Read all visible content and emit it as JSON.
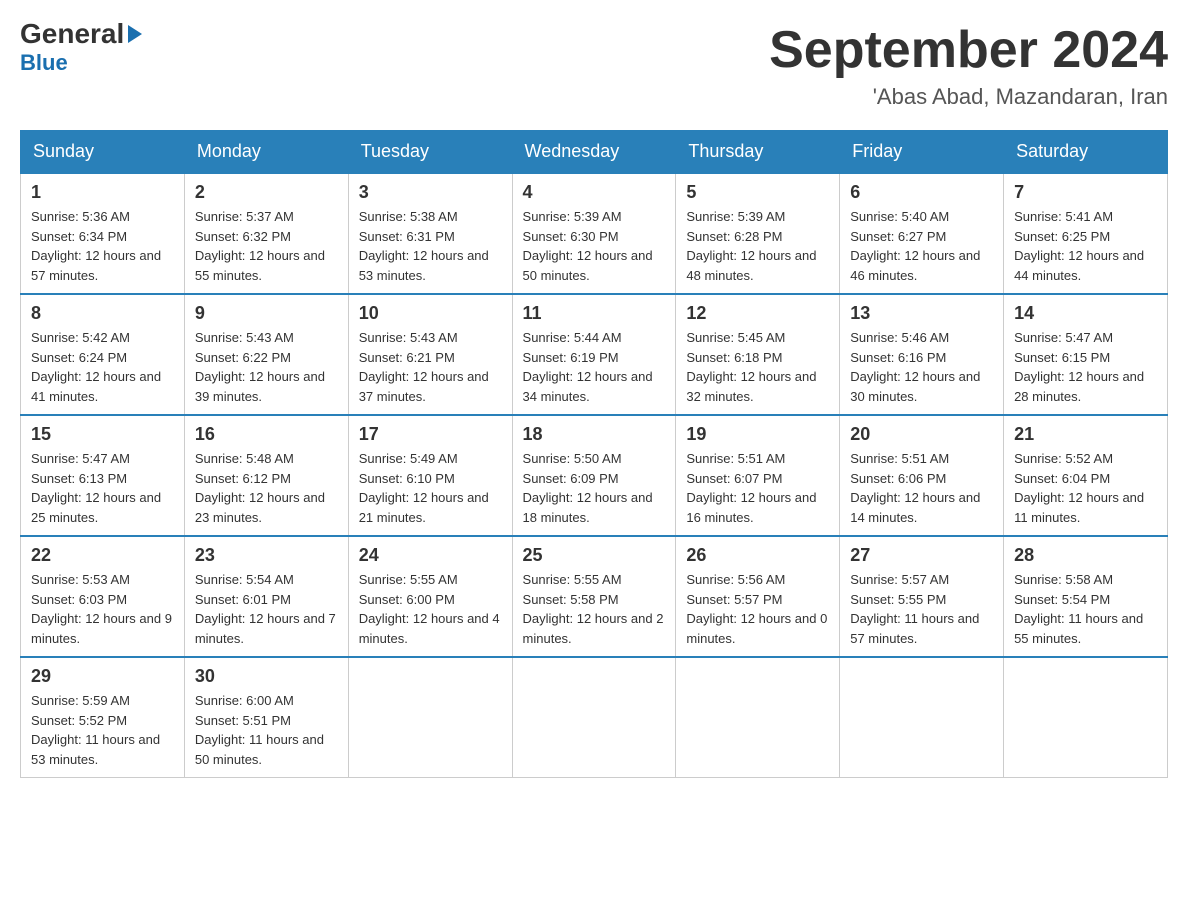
{
  "header": {
    "logo_general": "General",
    "logo_blue": "Blue",
    "logo_arrow": "▶",
    "title": "September 2024",
    "subtitle": "'Abas Abad, Mazandaran, Iran"
  },
  "days_of_week": [
    "Sunday",
    "Monday",
    "Tuesday",
    "Wednesday",
    "Thursday",
    "Friday",
    "Saturday"
  ],
  "weeks": [
    [
      {
        "date": "1",
        "sunrise": "5:36 AM",
        "sunset": "6:34 PM",
        "daylight": "12 hours and 57 minutes."
      },
      {
        "date": "2",
        "sunrise": "5:37 AM",
        "sunset": "6:32 PM",
        "daylight": "12 hours and 55 minutes."
      },
      {
        "date": "3",
        "sunrise": "5:38 AM",
        "sunset": "6:31 PM",
        "daylight": "12 hours and 53 minutes."
      },
      {
        "date": "4",
        "sunrise": "5:39 AM",
        "sunset": "6:30 PM",
        "daylight": "12 hours and 50 minutes."
      },
      {
        "date": "5",
        "sunrise": "5:39 AM",
        "sunset": "6:28 PM",
        "daylight": "12 hours and 48 minutes."
      },
      {
        "date": "6",
        "sunrise": "5:40 AM",
        "sunset": "6:27 PM",
        "daylight": "12 hours and 46 minutes."
      },
      {
        "date": "7",
        "sunrise": "5:41 AM",
        "sunset": "6:25 PM",
        "daylight": "12 hours and 44 minutes."
      }
    ],
    [
      {
        "date": "8",
        "sunrise": "5:42 AM",
        "sunset": "6:24 PM",
        "daylight": "12 hours and 41 minutes."
      },
      {
        "date": "9",
        "sunrise": "5:43 AM",
        "sunset": "6:22 PM",
        "daylight": "12 hours and 39 minutes."
      },
      {
        "date": "10",
        "sunrise": "5:43 AM",
        "sunset": "6:21 PM",
        "daylight": "12 hours and 37 minutes."
      },
      {
        "date": "11",
        "sunrise": "5:44 AM",
        "sunset": "6:19 PM",
        "daylight": "12 hours and 34 minutes."
      },
      {
        "date": "12",
        "sunrise": "5:45 AM",
        "sunset": "6:18 PM",
        "daylight": "12 hours and 32 minutes."
      },
      {
        "date": "13",
        "sunrise": "5:46 AM",
        "sunset": "6:16 PM",
        "daylight": "12 hours and 30 minutes."
      },
      {
        "date": "14",
        "sunrise": "5:47 AM",
        "sunset": "6:15 PM",
        "daylight": "12 hours and 28 minutes."
      }
    ],
    [
      {
        "date": "15",
        "sunrise": "5:47 AM",
        "sunset": "6:13 PM",
        "daylight": "12 hours and 25 minutes."
      },
      {
        "date": "16",
        "sunrise": "5:48 AM",
        "sunset": "6:12 PM",
        "daylight": "12 hours and 23 minutes."
      },
      {
        "date": "17",
        "sunrise": "5:49 AM",
        "sunset": "6:10 PM",
        "daylight": "12 hours and 21 minutes."
      },
      {
        "date": "18",
        "sunrise": "5:50 AM",
        "sunset": "6:09 PM",
        "daylight": "12 hours and 18 minutes."
      },
      {
        "date": "19",
        "sunrise": "5:51 AM",
        "sunset": "6:07 PM",
        "daylight": "12 hours and 16 minutes."
      },
      {
        "date": "20",
        "sunrise": "5:51 AM",
        "sunset": "6:06 PM",
        "daylight": "12 hours and 14 minutes."
      },
      {
        "date": "21",
        "sunrise": "5:52 AM",
        "sunset": "6:04 PM",
        "daylight": "12 hours and 11 minutes."
      }
    ],
    [
      {
        "date": "22",
        "sunrise": "5:53 AM",
        "sunset": "6:03 PM",
        "daylight": "12 hours and 9 minutes."
      },
      {
        "date": "23",
        "sunrise": "5:54 AM",
        "sunset": "6:01 PM",
        "daylight": "12 hours and 7 minutes."
      },
      {
        "date": "24",
        "sunrise": "5:55 AM",
        "sunset": "6:00 PM",
        "daylight": "12 hours and 4 minutes."
      },
      {
        "date": "25",
        "sunrise": "5:55 AM",
        "sunset": "5:58 PM",
        "daylight": "12 hours and 2 minutes."
      },
      {
        "date": "26",
        "sunrise": "5:56 AM",
        "sunset": "5:57 PM",
        "daylight": "12 hours and 0 minutes."
      },
      {
        "date": "27",
        "sunrise": "5:57 AM",
        "sunset": "5:55 PM",
        "daylight": "11 hours and 57 minutes."
      },
      {
        "date": "28",
        "sunrise": "5:58 AM",
        "sunset": "5:54 PM",
        "daylight": "11 hours and 55 minutes."
      }
    ],
    [
      {
        "date": "29",
        "sunrise": "5:59 AM",
        "sunset": "5:52 PM",
        "daylight": "11 hours and 53 minutes."
      },
      {
        "date": "30",
        "sunrise": "6:00 AM",
        "sunset": "5:51 PM",
        "daylight": "11 hours and 50 minutes."
      },
      null,
      null,
      null,
      null,
      null
    ]
  ]
}
